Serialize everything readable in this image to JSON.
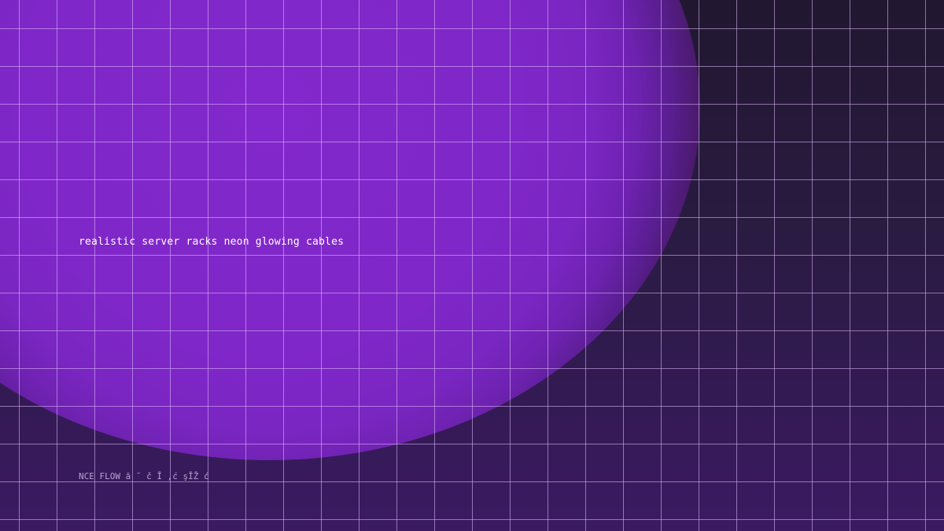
{
  "caption": "realistic server racks neon glowing cables",
  "footer": "NCE FLOW ā ˘ č  Ī ,ć şĪŽ ć",
  "colors": {
    "background": "#221833",
    "glow": "#8228cc",
    "grid_line": "#e1beff",
    "caption_text": "#ffffff",
    "footer_text": "#b7a2d2"
  }
}
